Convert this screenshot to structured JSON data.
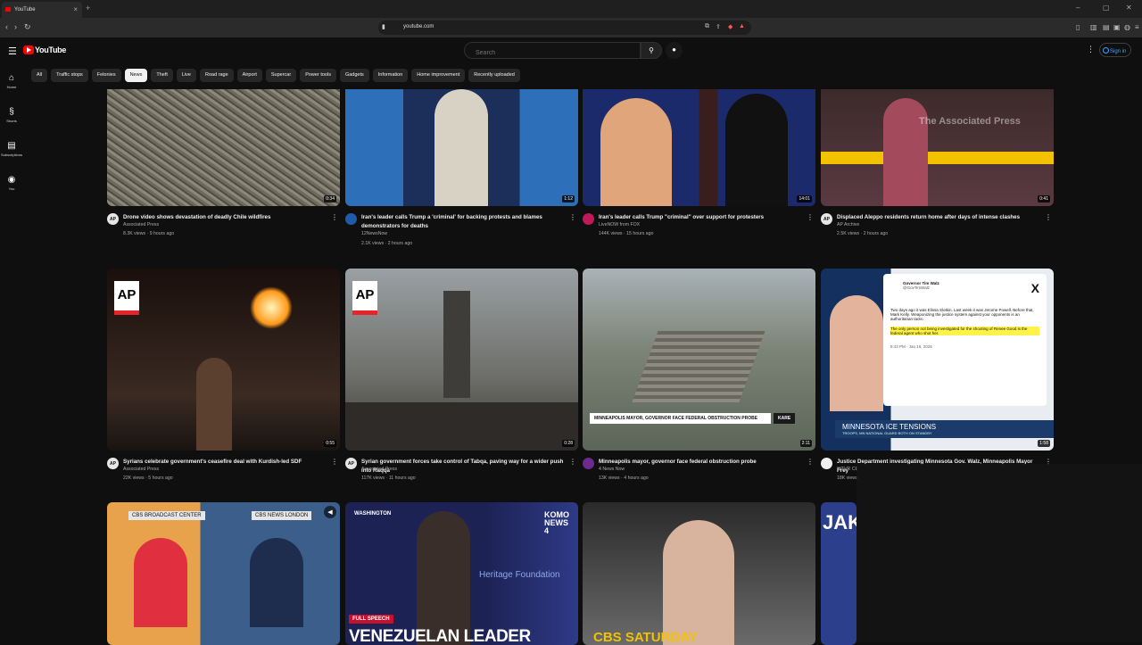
{
  "browser": {
    "tab_title": "YouTube",
    "url": "youtube.com"
  },
  "header": {
    "logo_text": "YouTube",
    "search_placeholder": "Search",
    "signin_label": "Sign in"
  },
  "sidebar": [
    {
      "label": "Home",
      "icon": "home-icon"
    },
    {
      "label": "Shorts",
      "icon": "shorts-icon"
    },
    {
      "label": "Subscriptions",
      "icon": "subscriptions-icon"
    },
    {
      "label": "You",
      "icon": "you-icon"
    }
  ],
  "chips": [
    "All",
    "Traffic stops",
    "Felonies",
    "News",
    "Theft",
    "Live",
    "Road rage",
    "Airport",
    "Supercar",
    "Power tools",
    "Gadgets",
    "Information",
    "Home improvement",
    "Recently uploaded"
  ],
  "active_chip": "News",
  "videos": [
    {
      "title": "Drone video shows devastation of deadly Chile wildfires",
      "channel": "Associated Press",
      "stats": "8.3K views · 9 hours ago",
      "duration": "0:34",
      "avatar": "AP"
    },
    {
      "title": "Iran's leader calls Trump a 'criminal' for backing protests and blames demonstrators for deaths",
      "channel": "12NewsNow",
      "stats": "2.1K views · 2 hours ago",
      "duration": "1:12",
      "avatar": ""
    },
    {
      "title": "Iran's leader calls Trump \"criminal\" over support for protesters",
      "channel": "LiveNOW from FOX",
      "stats": "144K views · 15 hours ago",
      "duration": "14:01",
      "avatar": ""
    },
    {
      "title": "Displaced Aleppo residents return home after days of intense clashes",
      "channel": "AP Archive",
      "stats": "2.5K views · 2 hours ago",
      "duration": "0:41",
      "avatar": "AP"
    },
    {
      "title": "Syrians celebrate government's ceasefire deal with Kurdish-led SDF",
      "channel": "Associated Press",
      "stats": "22K views · 5 hours ago",
      "duration": "0:55",
      "avatar": "AP"
    },
    {
      "title": "Syrian government forces take control of Tabqa, paving way for a wider push into Raqqa",
      "channel": "Associated Press",
      "stats": "117K views · 11 hours ago",
      "duration": "0:28",
      "avatar": "AP"
    },
    {
      "title": "Minneapolis mayor, governor face federal obstruction probe",
      "channel": "4 News Now",
      "stats": "13K views · 4 hours ago",
      "duration": "2:11",
      "avatar": ""
    },
    {
      "title": "Justice Department investigating Minnesota Gov. Walz, Minneapolis Mayor Frey",
      "channel": "WTVR CE",
      "stats": "18K views",
      "duration": "1:58",
      "avatar": ""
    }
  ],
  "thumb_text": {
    "ap": "AP",
    "ap_watermark": "The Associated Press",
    "fox_caption": "MINNEAPOLIS MAYOR, GOVERNOR FACE FEDERAL OBSTRUCTION PROBE",
    "kare": "KARE",
    "tweet_name": "Governor Tim Walz",
    "tweet_handle": "@GovTimWalz",
    "tweet_body": "Two days ago it was Elissa Slotkin. Last week it was Jerome Powell. Before that, Mark Kelly. Weaponizing the justice system against your opponents is an authoritarian tactic.",
    "tweet_highlight": "The only person not being investigated for the shooting of Renee Good is the federal agent who shot her.",
    "tweet_time": "8:43 PM · Jan 16, 2026",
    "banner_title": "MINNESOTA ICE TENSIONS",
    "banner_sub": "TROOPS, MN NATIONAL GUARD BOTH ON STANDBY",
    "cbs_left": "CBS BROADCAST CENTER",
    "cbs_right": "CBS NEWS LONDON",
    "washington": "WASHINGTON",
    "komo": "KOMO NEWS 4",
    "heritage": "Heritage Foundation",
    "full_speech": "FULL SPEECH",
    "venezuelan": "VENEZUELAN LEADER",
    "cbs_saturday": "CBS SATURDAY",
    "jak": "JAK"
  }
}
